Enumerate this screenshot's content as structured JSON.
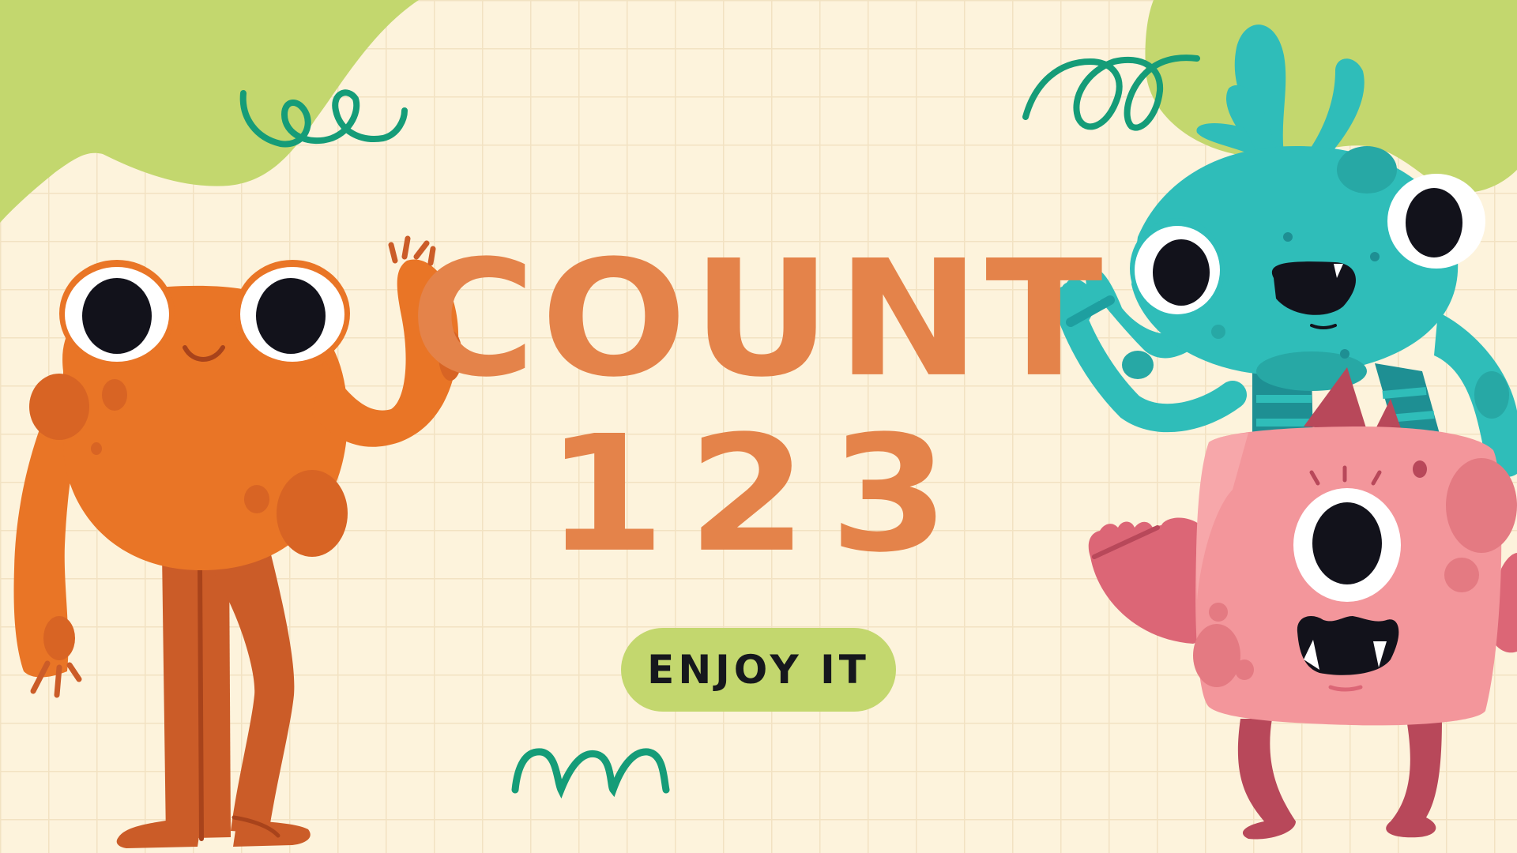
{
  "title": {
    "line1": "COUNT",
    "line2": "123"
  },
  "cta": {
    "label": "ENJOY IT"
  },
  "icons": [
    "orange-monster-illustration",
    "teal-monster-illustration",
    "pink-cyclops-monster-illustration",
    "swirl-doodle",
    "zigzag-doodle",
    "green-blob"
  ],
  "colors": {
    "background": "#fdf3dc",
    "grid": "#f2e2c2",
    "title": "#e4834a",
    "button": "#c3d76e",
    "button_text": "#16171d",
    "blob": "#c3d76e",
    "doodle": "#159c78",
    "orange_monster": "#e97526",
    "teal_monster": "#2fbdb9",
    "pink_monster": "#f3969b"
  }
}
